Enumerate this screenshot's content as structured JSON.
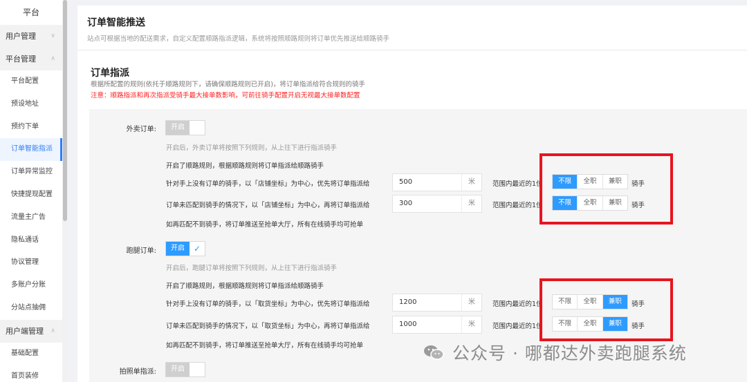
{
  "sidebar": {
    "top": "平台",
    "groups": [
      {
        "label": "用户管理",
        "chev": "∨"
      },
      {
        "label": "平台管理",
        "chev": "∧"
      },
      {
        "label": "用户端管理",
        "chev": "∧"
      }
    ],
    "items": [
      "平台配置",
      "预设地址",
      "预约下单",
      "订单智能指派",
      "订单异常监控",
      "快捷提现配置",
      "流量主广告",
      "隐私通话",
      "协议管理",
      "多账户分账",
      "分站点抽佣"
    ],
    "items2": [
      "基础配置",
      "首页装修"
    ]
  },
  "header": {
    "title": "订单智能推送",
    "desc": "站点可根据当地的配送需求，自定义配置顺路指派逻辑，系统将按照顺路规则将订单优先推送给顺路骑手"
  },
  "section": {
    "title": "订单指派",
    "desc": "根据所配置的规则(依托于顺路规则下，请确保顺路规则已开启)，将订单指派给符合规则的骑手",
    "warning": "注意：顺路指派和再次指派受骑手最大接单数影响，可前往骑手配置开启无视最大接单数配置"
  },
  "waimai": {
    "label": "外卖订单:",
    "toggle_on": "开启",
    "note": "开启后，外卖订单将按照下列规则，从上往下进行指派骑手",
    "rule_on": "开启了顺路规则，根据顺路规则将订单指派给顺路骑手",
    "rule1": "针对手上没有订单的骑手，以「店铺坐标」为中心，优先将订单指派给",
    "rule2": "订单未匹配到骑手的情况下，以「店铺坐标」为中心，再将订单指派给",
    "dist1": "500",
    "dist2": "300",
    "fallback": "如再匹配不到骑手，将订单推送至抢单大厅，所有在线骑手均可抢单"
  },
  "paotui": {
    "label": "跑腿订单:",
    "toggle_on": "开启",
    "check": "✓",
    "note": "开启后，跑腿订单将按照下列规则，从上往下进行指派骑手",
    "rule_on": "开启了顺路规则，根据顺路规则将订单指派给顺路骑手",
    "rule1": "针对手上没有订单的骑手，以「取货坐标」为中心，优先将订单指派给",
    "rule2": "订单未匹配到骑手的情况下，以「取货坐标」为中心，再将订单指派给",
    "dist1": "1200",
    "dist2": "1000",
    "fallback": "如再匹配不到骑手，将订单推送至抢单大厅，所有在线骑手均可抢单"
  },
  "paizhao": {
    "label": "拍照单指派:",
    "toggle_on": "开启"
  },
  "common": {
    "unit": "米",
    "range_text": "范围内最近的1位",
    "rider": "骑手",
    "seg_options": [
      "不限",
      "全职",
      "兼职"
    ]
  },
  "watermark": {
    "text": "公众号 · 哪都达外卖跑腿系统"
  }
}
